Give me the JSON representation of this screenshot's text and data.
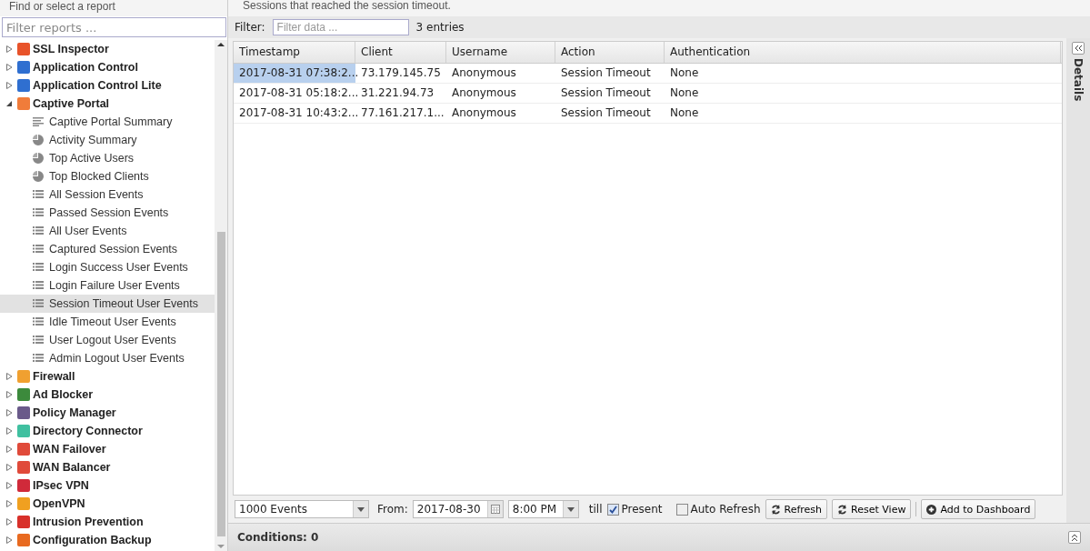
{
  "sidebar": {
    "title": "Find or select a report",
    "filter": {
      "placeholder": "Filter reports ..."
    },
    "apps": [
      {
        "name": "SSL Inspector",
        "color": "#e8532a",
        "expanded": false
      },
      {
        "name": "Application Control",
        "color": "#2f6fd0",
        "expanded": false
      },
      {
        "name": "Application Control Lite",
        "color": "#2f6fd0",
        "expanded": false
      },
      {
        "name": "Captive Portal",
        "color": "#f07c3a",
        "expanded": true,
        "children": [
          {
            "label": "Captive Portal Summary",
            "kind": "text",
            "selected": false
          },
          {
            "label": "Activity Summary",
            "kind": "pie",
            "selected": false
          },
          {
            "label": "Top Active Users",
            "kind": "pie",
            "selected": false
          },
          {
            "label": "Top Blocked Clients",
            "kind": "pie",
            "selected": false
          },
          {
            "label": "All Session Events",
            "kind": "list",
            "selected": false
          },
          {
            "label": "Passed Session Events",
            "kind": "list",
            "selected": false
          },
          {
            "label": "All User Events",
            "kind": "list",
            "selected": false
          },
          {
            "label": "Captured Session Events",
            "kind": "list",
            "selected": false
          },
          {
            "label": "Login Success User Events",
            "kind": "list",
            "selected": false
          },
          {
            "label": "Login Failure User Events",
            "kind": "list",
            "selected": false
          },
          {
            "label": "Session Timeout User Events",
            "kind": "list",
            "selected": true
          },
          {
            "label": "Idle Timeout User Events",
            "kind": "list",
            "selected": false
          },
          {
            "label": "User Logout User Events",
            "kind": "list",
            "selected": false
          },
          {
            "label": "Admin Logout User Events",
            "kind": "list",
            "selected": false
          }
        ]
      },
      {
        "name": "Firewall",
        "color": "#f0a030",
        "expanded": false
      },
      {
        "name": "Ad Blocker",
        "color": "#3c8a3c",
        "expanded": false
      },
      {
        "name": "Policy Manager",
        "color": "#6a5a8a",
        "expanded": false
      },
      {
        "name": "Directory Connector",
        "color": "#40c0a0",
        "expanded": false
      },
      {
        "name": "WAN Failover",
        "color": "#e04a3a",
        "expanded": false
      },
      {
        "name": "WAN Balancer",
        "color": "#e04a3a",
        "expanded": false
      },
      {
        "name": "IPsec VPN",
        "color": "#d02a3a",
        "expanded": false
      },
      {
        "name": "OpenVPN",
        "color": "#f0a020",
        "expanded": false
      },
      {
        "name": "Intrusion Prevention",
        "color": "#d8302a",
        "expanded": false
      },
      {
        "name": "Configuration Backup",
        "color": "#e86a20",
        "expanded": false
      }
    ]
  },
  "report": {
    "description": "Sessions that reached the session timeout.",
    "filter_label": "Filter:",
    "filter": {
      "placeholder": "Filter data ..."
    },
    "count": "3 entries",
    "table": {
      "columns": [
        "Timestamp",
        "Client",
        "Username",
        "Action",
        "Authentication"
      ],
      "rows": [
        {
          "selected": true,
          "cells": [
            "2017-08-31 07:38:2...",
            "73.179.145.75",
            "Anonymous",
            "Session Timeout",
            "None"
          ]
        },
        {
          "selected": false,
          "cells": [
            "2017-08-31 05:18:2...",
            "31.221.94.73",
            "Anonymous",
            "Session Timeout",
            "None"
          ]
        },
        {
          "selected": false,
          "cells": [
            "2017-08-31 10:43:2...",
            "77.161.217.1...",
            "Anonymous",
            "Session Timeout",
            "None"
          ]
        }
      ]
    },
    "toolbar": {
      "limit": "1000 Events",
      "from_label": "From:",
      "date": "2017-08-30",
      "time": "8:00 PM",
      "till_label": "till",
      "present": {
        "label": "Present",
        "checked": true
      },
      "auto_refresh": {
        "label": "Auto Refresh",
        "checked": false
      },
      "buttons": [
        "Refresh",
        "Reset View",
        "Add to Dashboard"
      ]
    },
    "conditions": "Conditions: 0",
    "details_tab": "Details"
  }
}
